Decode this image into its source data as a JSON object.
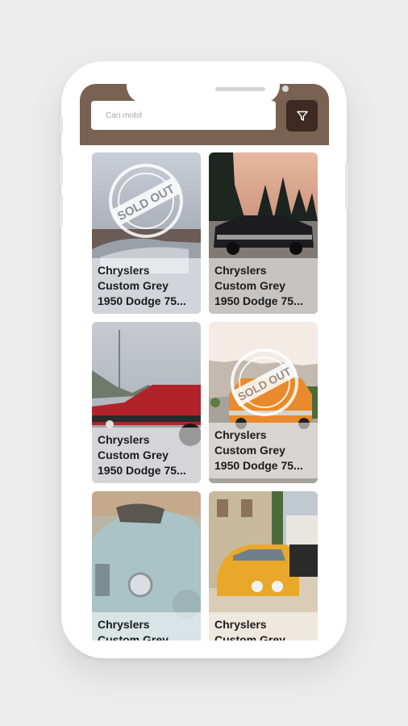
{
  "search": {
    "placeholder": "Cari mobil"
  },
  "filter": {
    "icon": "filter-icon"
  },
  "colors": {
    "header": "#7a6253",
    "filter_button": "#3e2a21"
  },
  "cars": [
    {
      "line1": "Chryslers",
      "line2": "Custom Grey",
      "line3": "1950 Dodge 75...",
      "sold_out": true,
      "stamp_text": "SOLD OUT"
    },
    {
      "line1": "Chryslers",
      "line2": "Custom Grey",
      "line3": "1950 Dodge 75...",
      "sold_out": false
    },
    {
      "line1": "Chryslers",
      "line2": "Custom Grey",
      "line3": "1950 Dodge 75...",
      "sold_out": false
    },
    {
      "line1": "Chryslers",
      "line2": "Custom Grey",
      "line3": "1950 Dodge 75...",
      "sold_out": true,
      "stamp_text": "SOLD OUT"
    },
    {
      "line1": "Chryslers",
      "line2": "Custom Grey",
      "sold_out": false
    },
    {
      "line1": "Chryslers",
      "line2": "Custom Grey",
      "sold_out": false
    }
  ]
}
